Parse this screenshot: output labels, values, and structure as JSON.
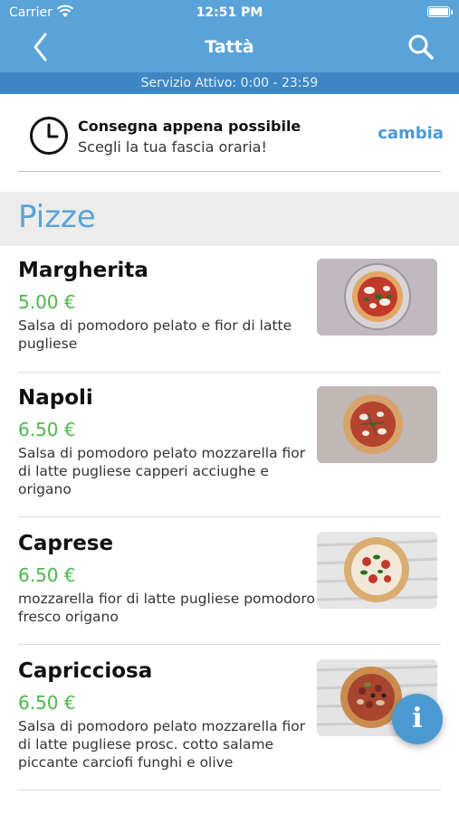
{
  "status_bar": {
    "carrier": "Carrier",
    "time": "12:51 PM"
  },
  "header": {
    "title": "Tattà",
    "back_icon": "chevron-left-icon",
    "search_icon": "search-icon"
  },
  "service_bar": {
    "text": "Servizio Attivo: 0:00 - 23:59"
  },
  "delivery": {
    "title": "Consegna appena possibile",
    "subtitle": "Scegli la tua fascia oraria!",
    "change_label": "cambia",
    "icon": "clock-icon"
  },
  "section": {
    "title": "Pizze"
  },
  "items": [
    {
      "name": "Margherita",
      "price": "5.00 €",
      "description": "Salsa di pomodoro pelato e fior di latte pugliese"
    },
    {
      "name": "Napoli",
      "price": "6.50 €",
      "description": "Salsa di pomodoro pelato mozzarella fior di latte pugliese capperi acciughe e origano"
    },
    {
      "name": "Caprese",
      "price": "6.50 €",
      "description": "mozzarella fior di latte pugliese pomodoro fresco origano"
    },
    {
      "name": "Capricciosa",
      "price": "6.50 €",
      "description": "Salsa di pomodoro pelato mozzarella fior di latte pugliese prosc. cotto salame piccante carciofi funghi e olive"
    }
  ],
  "info_button": {
    "label": "i",
    "icon": "info-icon"
  },
  "colors": {
    "header": "#5aa3d8",
    "service_bar": "#3f86c4",
    "accent": "#4a9ad1",
    "price": "#4cb84c"
  }
}
